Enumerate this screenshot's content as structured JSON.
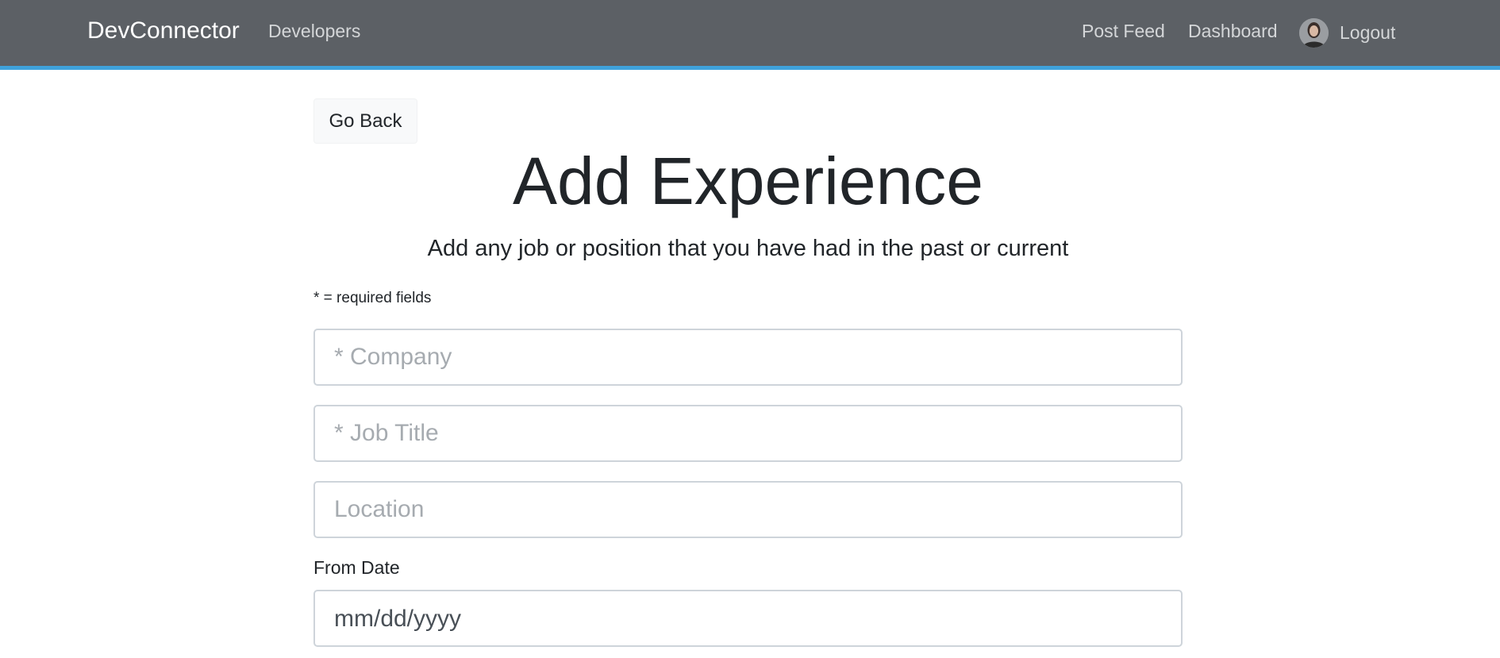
{
  "navbar": {
    "brand": "DevConnector",
    "left_links": [
      {
        "label": "Developers"
      }
    ],
    "right_links": [
      {
        "label": "Post Feed"
      },
      {
        "label": "Dashboard"
      }
    ],
    "logout_label": "Logout",
    "avatar_icon": "user-avatar",
    "accent_color": "#3fa2db",
    "background_color": "#5c6065"
  },
  "main": {
    "go_back_label": "Go Back",
    "title": "Add Experience",
    "lead": "Add any job or position that you have had in the past or current",
    "required_note": "* = required fields",
    "fields": {
      "company": {
        "placeholder": "* Company",
        "value": ""
      },
      "job_title": {
        "placeholder": "* Job Title",
        "value": ""
      },
      "location": {
        "placeholder": "Location",
        "value": ""
      },
      "from_date": {
        "label": "From Date",
        "placeholder": "mm/dd/yyyy",
        "value": ""
      }
    }
  }
}
